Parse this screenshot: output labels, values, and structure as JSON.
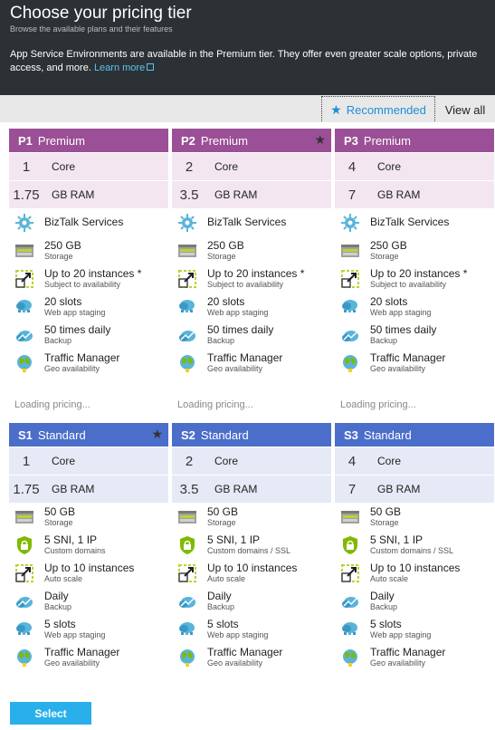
{
  "header": {
    "title": "Choose your pricing tier",
    "subtitle": "Browse the available plans and their features",
    "description": "App Service Environments are available in the Premium tier. They offer even greater scale options, private access, and more.",
    "learn_more": "Learn more"
  },
  "toggle": {
    "recommended": "Recommended",
    "view_all": "View all"
  },
  "cards": [
    {
      "code": "P1",
      "tier": "Premium",
      "starred": false,
      "core": "1",
      "core_label": "Core",
      "ram": "1.75",
      "ram_label": "GB RAM",
      "features": [
        {
          "icon": "biztalk-icon",
          "title": "BizTalk Services",
          "sub": ""
        },
        {
          "icon": "storage-icon",
          "title": "250 GB",
          "sub": "Storage"
        },
        {
          "icon": "scale-icon",
          "title": "Up to 20 instances *",
          "sub": "Subject to availability"
        },
        {
          "icon": "slots-icon",
          "title": "20 slots",
          "sub": "Web app staging"
        },
        {
          "icon": "backup-icon",
          "title": "50 times daily",
          "sub": "Backup"
        },
        {
          "icon": "traffic-manager-icon",
          "title": "Traffic Manager",
          "sub": "Geo availability"
        }
      ],
      "loading": "Loading pricing..."
    },
    {
      "code": "P2",
      "tier": "Premium",
      "starred": true,
      "core": "2",
      "core_label": "Core",
      "ram": "3.5",
      "ram_label": "GB RAM",
      "features": [
        {
          "icon": "biztalk-icon",
          "title": "BizTalk Services",
          "sub": ""
        },
        {
          "icon": "storage-icon",
          "title": "250 GB",
          "sub": "Storage"
        },
        {
          "icon": "scale-icon",
          "title": "Up to 20 instances *",
          "sub": "Subject to availability"
        },
        {
          "icon": "slots-icon",
          "title": "20 slots",
          "sub": "Web app staging"
        },
        {
          "icon": "backup-icon",
          "title": "50 times daily",
          "sub": "Backup"
        },
        {
          "icon": "traffic-manager-icon",
          "title": "Traffic Manager",
          "sub": "Geo availability"
        }
      ],
      "loading": "Loading pricing..."
    },
    {
      "code": "P3",
      "tier": "Premium",
      "starred": false,
      "core": "4",
      "core_label": "Core",
      "ram": "7",
      "ram_label": "GB RAM",
      "features": [
        {
          "icon": "biztalk-icon",
          "title": "BizTalk Services",
          "sub": ""
        },
        {
          "icon": "storage-icon",
          "title": "250 GB",
          "sub": "Storage"
        },
        {
          "icon": "scale-icon",
          "title": "Up to 20 instances *",
          "sub": "Subject to availability"
        },
        {
          "icon": "slots-icon",
          "title": "20 slots",
          "sub": "Web app staging"
        },
        {
          "icon": "backup-icon",
          "title": "50 times daily",
          "sub": "Backup"
        },
        {
          "icon": "traffic-manager-icon",
          "title": "Traffic Manager",
          "sub": "Geo availability"
        }
      ],
      "loading": "Loading pricing..."
    },
    {
      "code": "S1",
      "tier": "Standard",
      "starred": true,
      "core": "1",
      "core_label": "Core",
      "ram": "1.75",
      "ram_label": "GB RAM",
      "features": [
        {
          "icon": "storage-icon",
          "title": "50 GB",
          "sub": "Storage"
        },
        {
          "icon": "lock-icon",
          "title": "5 SNI, 1 IP",
          "sub": "Custom domains"
        },
        {
          "icon": "scale-icon",
          "title": "Up to 10 instances",
          "sub": "Auto scale"
        },
        {
          "icon": "backup-icon",
          "title": "Daily",
          "sub": "Backup"
        },
        {
          "icon": "slots-icon",
          "title": "5 slots",
          "sub": "Web app staging"
        },
        {
          "icon": "traffic-manager-icon",
          "title": "Traffic Manager",
          "sub": "Geo availability"
        }
      ],
      "loading": ""
    },
    {
      "code": "S2",
      "tier": "Standard",
      "starred": false,
      "core": "2",
      "core_label": "Core",
      "ram": "3.5",
      "ram_label": "GB RAM",
      "features": [
        {
          "icon": "storage-icon",
          "title": "50 GB",
          "sub": "Storage"
        },
        {
          "icon": "lock-icon",
          "title": "5 SNI, 1 IP",
          "sub": "Custom domains / SSL"
        },
        {
          "icon": "scale-icon",
          "title": "Up to 10 instances",
          "sub": "Auto scale"
        },
        {
          "icon": "backup-icon",
          "title": "Daily",
          "sub": "Backup"
        },
        {
          "icon": "slots-icon",
          "title": "5 slots",
          "sub": "Web app staging"
        },
        {
          "icon": "traffic-manager-icon",
          "title": "Traffic Manager",
          "sub": "Geo availability"
        }
      ],
      "loading": ""
    },
    {
      "code": "S3",
      "tier": "Standard",
      "starred": false,
      "core": "4",
      "core_label": "Core",
      "ram": "7",
      "ram_label": "GB RAM",
      "features": [
        {
          "icon": "storage-icon",
          "title": "50 GB",
          "sub": "Storage"
        },
        {
          "icon": "lock-icon",
          "title": "5 SNI, 1 IP",
          "sub": "Custom domains / SSL"
        },
        {
          "icon": "scale-icon",
          "title": "Up to 10 instances",
          "sub": "Auto scale"
        },
        {
          "icon": "backup-icon",
          "title": "Daily",
          "sub": "Backup"
        },
        {
          "icon": "slots-icon",
          "title": "5 slots",
          "sub": "Web app staging"
        },
        {
          "icon": "traffic-manager-icon",
          "title": "Traffic Manager",
          "sub": "Geo availability"
        }
      ],
      "loading": ""
    }
  ],
  "footer": {
    "select_label": "Select"
  },
  "colors": {
    "premium": "#9b4f96",
    "standard": "#4a6ec9",
    "accent": "#29b0ea"
  }
}
